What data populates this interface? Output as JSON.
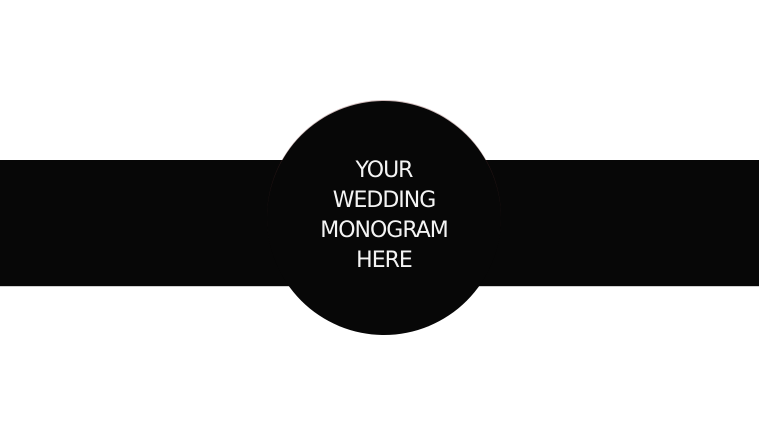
{
  "seal": {
    "lines": [
      "YOUR",
      "WEDDING",
      "MONOGRAM",
      "HERE"
    ]
  },
  "colors": {
    "band": "#070707",
    "text": "#f4f4f4",
    "background": "#ffffff"
  }
}
